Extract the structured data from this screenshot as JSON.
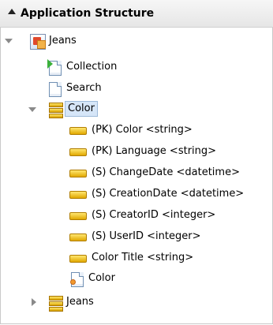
{
  "panel": {
    "title": "Application Structure"
  },
  "tree": {
    "root": "Jeans",
    "collection": "Collection",
    "search": "Search",
    "color_group": "Color",
    "fields": [
      "(PK) Color <string>",
      "(PK) Language <string>",
      "(S) ChangeDate <datetime>",
      "(S) CreationDate <datetime>",
      "(S) CreatorID <integer>",
      "(S) UserID <integer>",
      "Color Title <string>"
    ],
    "color_doc": "Color",
    "jeans_group": "Jeans"
  }
}
